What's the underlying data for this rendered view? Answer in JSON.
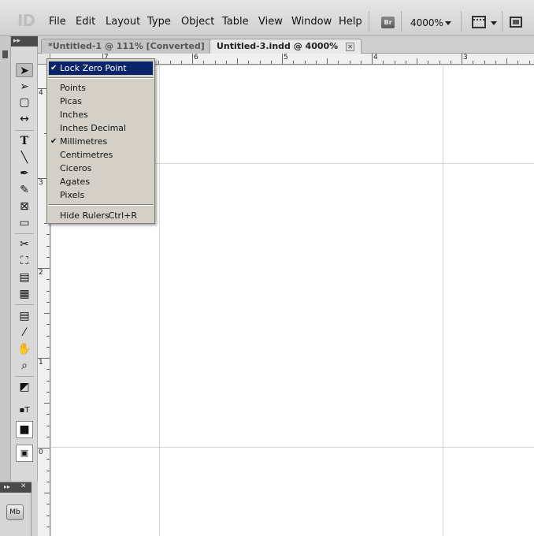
{
  "app": {
    "logo": "ID"
  },
  "menubar": {
    "items": [
      "File",
      "Edit",
      "Layout",
      "Type",
      "Object",
      "Table",
      "View",
      "Window",
      "Help"
    ],
    "bridge_label": "Br",
    "zoom": "4000%"
  },
  "tools_panel": {
    "collapse_glyph": "▸▸"
  },
  "tabs": [
    {
      "label": "*Untitled-1 @ 111% [Converted]",
      "close": "✕"
    },
    {
      "label": "Untitled-3.indd @ 4000%",
      "close": "✕"
    }
  ],
  "rulers": {
    "horizontal_labels": [
      "7",
      "6",
      "5",
      "4",
      "3"
    ],
    "vertical_labels": [
      "4",
      "3",
      "2",
      "1",
      "0"
    ]
  },
  "context_menu": {
    "items": [
      {
        "label": "Lock Zero Point",
        "checked": true,
        "highlighted": true
      },
      {
        "label": "Points"
      },
      {
        "label": "Picas"
      },
      {
        "label": "Inches"
      },
      {
        "label": "Inches Decimal"
      },
      {
        "label": "Millimetres",
        "checked": true
      },
      {
        "label": "Centimetres"
      },
      {
        "label": "Ciceros"
      },
      {
        "label": "Agates"
      },
      {
        "label": "Pixels"
      },
      {
        "label": "Hide Rulers",
        "shortcut": "Ctrl+R"
      }
    ],
    "check_glyph": "✔"
  },
  "mini_panel": {
    "icon_label": "Mb",
    "close": "✕",
    "collapse": "▸▸"
  },
  "colors": {
    "menu_highlight": "#0a246a",
    "menu_background": "#d4d0c8",
    "panel_header": "#4a4a4a"
  }
}
